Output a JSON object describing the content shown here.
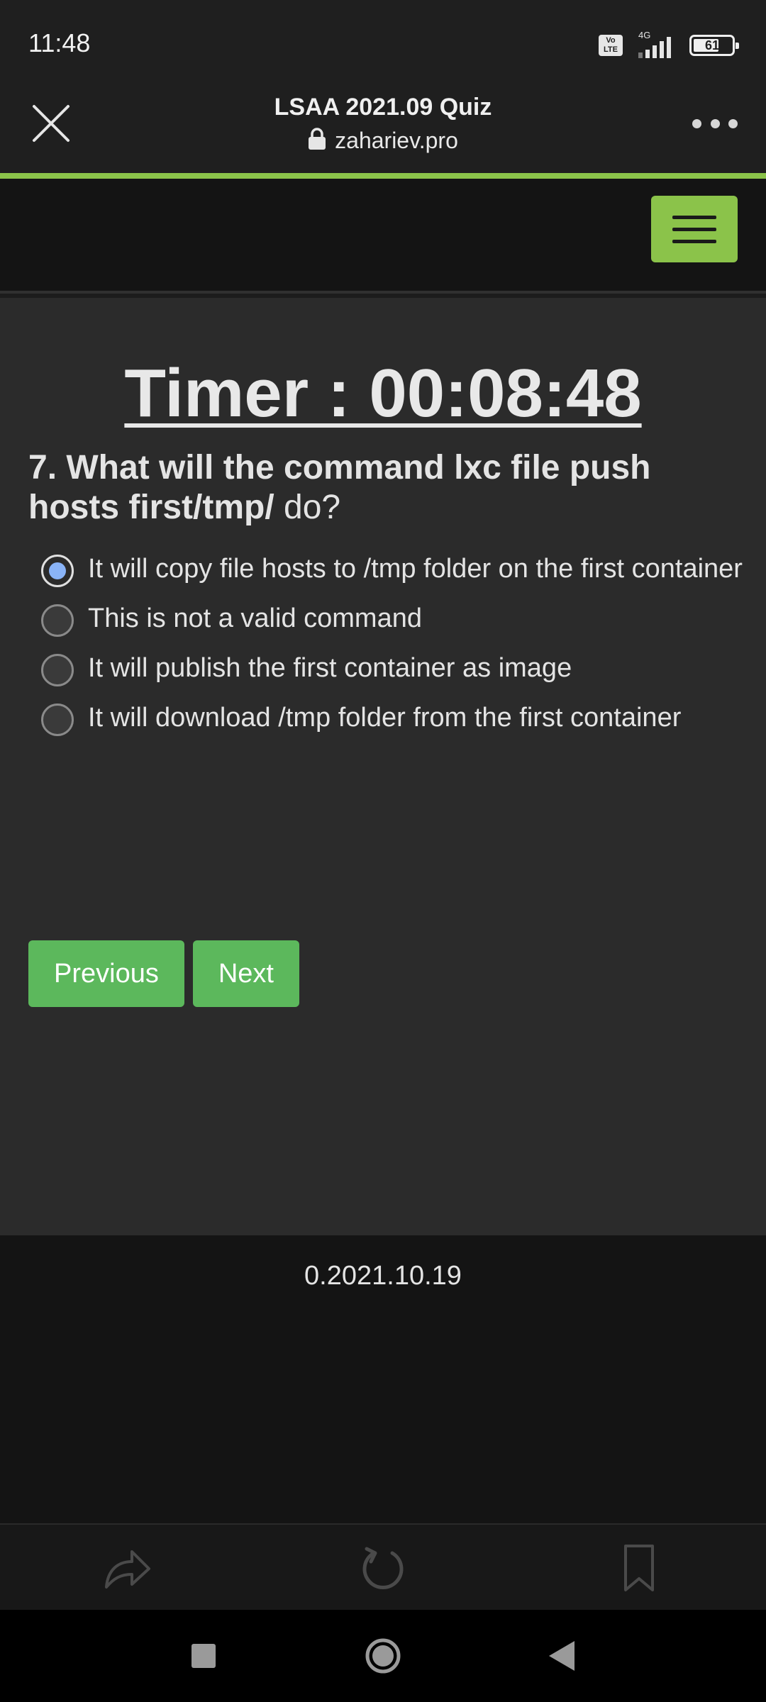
{
  "status_bar": {
    "time": "11:48",
    "volte_label": "Vo\nLTE",
    "network_label": "4G",
    "battery_level": "61"
  },
  "browser": {
    "page_title": "LSAA 2021.09 Quiz",
    "url": "zahariev.pro",
    "accent_color": "#8bc34a"
  },
  "quiz": {
    "timer": "Timer : 00:08:48",
    "question_number": "7.",
    "question_bold": " What will the command lxc file push hosts first/tmp/",
    "question_tail": " do?",
    "answers": [
      {
        "label": "It will copy file hosts to /tmp folder on the first container",
        "selected": true
      },
      {
        "label": "This is not a valid command",
        "selected": false
      },
      {
        "label": "It will publish the first container as image",
        "selected": false
      },
      {
        "label": "It will download /tmp folder from the first container",
        "selected": false
      }
    ],
    "previous_label": "Previous",
    "next_label": "Next",
    "button_color": "#5cb85c"
  },
  "footer": {
    "version": "0.2021.10.19"
  },
  "icons": {
    "close": "close-icon",
    "lock": "lock-icon",
    "more": "more-options-icon",
    "menu": "hamburger-menu-icon",
    "share": "share-icon",
    "reload": "reload-icon",
    "bookmark": "bookmark-icon",
    "recents": "recents-icon",
    "home": "home-icon",
    "back": "back-icon"
  }
}
